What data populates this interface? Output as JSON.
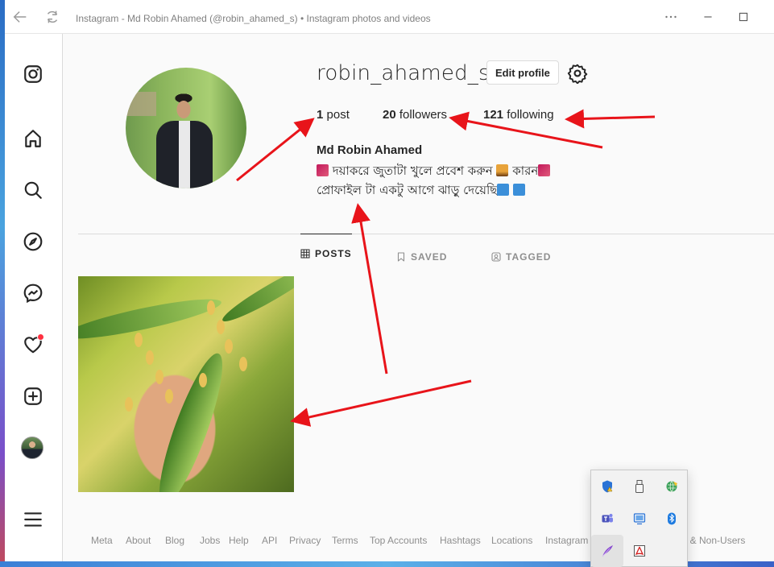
{
  "window": {
    "title": "Instagram - Md Robin Ahamed (@robin_ahamed_s) • Instagram photos and videos"
  },
  "sidebar": {
    "items": [
      {
        "icon": "instagram-logo-icon"
      },
      {
        "icon": "home-icon"
      },
      {
        "icon": "search-icon"
      },
      {
        "icon": "explore-compass-icon"
      },
      {
        "icon": "messenger-icon"
      },
      {
        "icon": "heart-icon",
        "badge": true
      },
      {
        "icon": "create-plus-icon"
      },
      {
        "icon": "profile-avatar"
      },
      {
        "icon": "menu-icon"
      }
    ]
  },
  "profile": {
    "username": "robin_ahamed_s",
    "edit_label": "Edit profile",
    "posts_count": "1",
    "posts_label": "post",
    "followers_count": "20",
    "followers_label": "followers",
    "following_count": "121",
    "following_label": "following",
    "full_name": "Md Robin Ahamed",
    "bio_line1_a": "দয়াকরে জুতাটা খুলে প্রবেশ করুন",
    "bio_line1_b": "কারন",
    "bio_line2": "প্রোফাইল টা একটু আগে ঝাড়ু দেয়েছি"
  },
  "tabs": [
    {
      "label": "POSTS",
      "icon": "grid-icon",
      "active": true
    },
    {
      "label": "SAVED",
      "icon": "bookmark-icon",
      "active": false
    },
    {
      "label": "TAGGED",
      "icon": "tagged-icon",
      "active": false
    }
  ],
  "footer": {
    "links": [
      "Meta",
      "About",
      "Blog",
      "Jobs",
      "Help",
      "API",
      "Privacy",
      "Terms",
      "Top Accounts",
      "Hashtags",
      "Locations",
      "Instagram",
      "ng & Non-Users"
    ]
  },
  "tray": {
    "icons": [
      "security-warning-icon",
      "usb-drive-icon",
      "network-globe-icon",
      "teams-icon",
      "display-icon",
      "bluetooth-icon",
      "pen-feather-icon",
      "pdf-app-icon"
    ]
  },
  "colors": {
    "accent_red": "#ff3040",
    "arrow_red": "#e8141a",
    "text": "#262626",
    "muted": "#8e8e8e"
  }
}
